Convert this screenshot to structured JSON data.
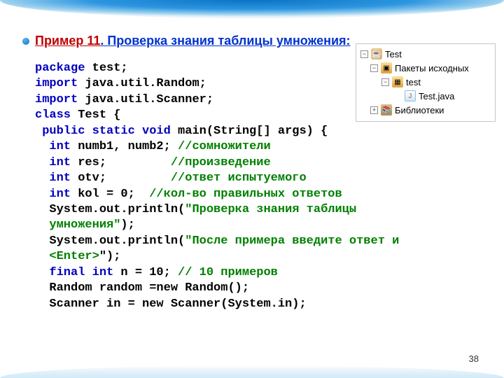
{
  "heading": {
    "prefix": "Пример  11",
    "rest": ". Проверка знания таблицы умножения:"
  },
  "code": {
    "l1a": "package",
    "l1b": " test;",
    "l2a": "import",
    "l2b": " java.util.Random;",
    "l3a": "import",
    "l3b": " java.util.Scanner;",
    "l4a": "class",
    "l4b": " Test {",
    "l5a": " public static void",
    "l5b": " main(String[] args) {",
    "l6a": "  int",
    "l6b": " numb1, numb2; ",
    "l6c": "//сомножители",
    "l7a": "  int",
    "l7b": " res;         ",
    "l7c": "//произведение",
    "l8a": "  int",
    "l8b": " otv;         ",
    "l8c": "//ответ испытуемого",
    "l9a": "  int",
    "l9b": " kol = 0;  ",
    "l9c": "//кол-во правильных ответов",
    "l10a": "  System.out.println(",
    "l10b": "\"Проверка знания таблицы",
    "l11a": "  умножения\"",
    "l11b": ");",
    "l12a": "  System.out.println(",
    "l12b": "\"После примера введите ответ и",
    "l13a": "  <Enter>",
    "l13b": "\");",
    "l14a": "  final int",
    "l14b": " n = 10; ",
    "l14c": "// 10 примеров",
    "l15": "  Random random =new Random();",
    "l16": "  Scanner in = new Scanner(System.in);"
  },
  "tree": {
    "root": "Test",
    "pkgSrc": "Пакеты исходных",
    "pkg": "test",
    "file": "Test.java",
    "lib": "Библиотеки"
  },
  "page": "38"
}
